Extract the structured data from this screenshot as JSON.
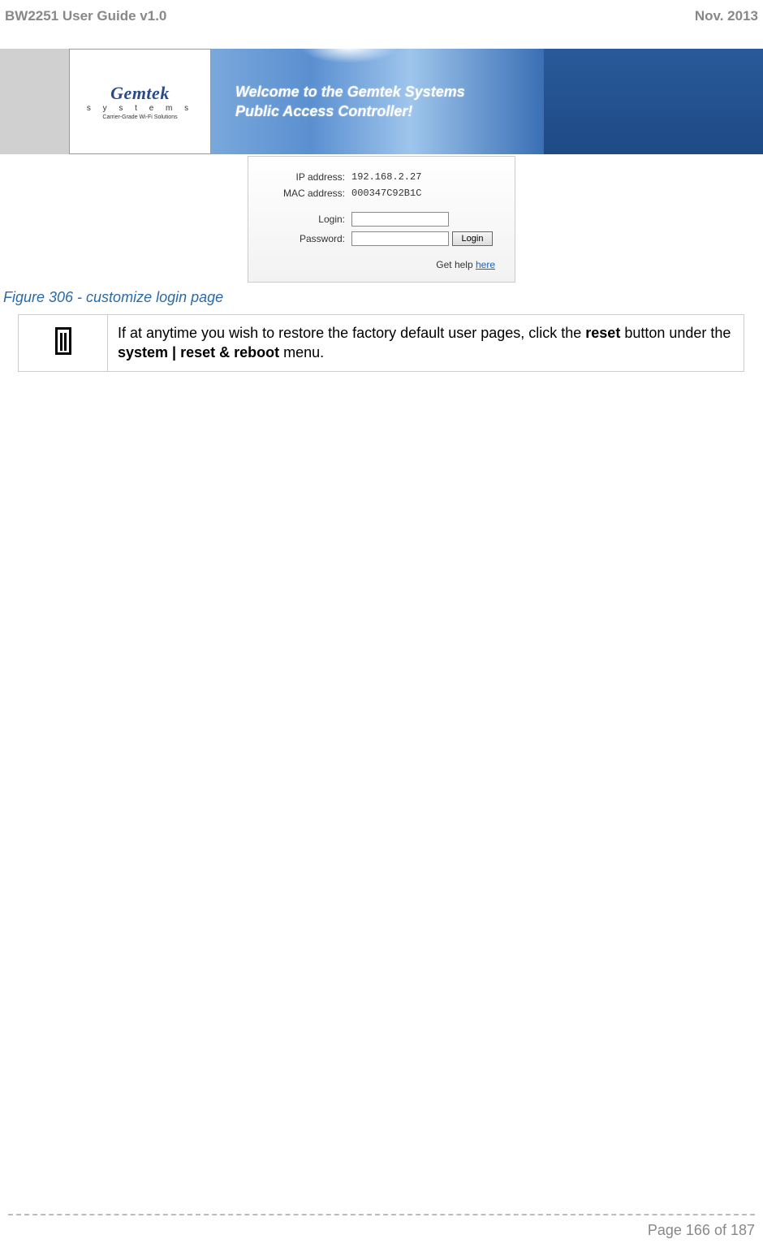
{
  "header": {
    "title": "BW2251 User Guide v1.0",
    "date": "Nov.  2013"
  },
  "logo": {
    "name": "Gemtek",
    "systems": "s y s t e m s",
    "tagline": "Carrier-Grade Wi-Fi Solutions"
  },
  "welcome": {
    "line1": "Welcome to the Gemtek Systems",
    "line2": "Public Access Controller!"
  },
  "login": {
    "ip_label": "IP address:",
    "ip_value": "192.168.2.27",
    "mac_label": "MAC address:",
    "mac_value": "000347C92B1C",
    "login_label": "Login:",
    "login_value": "",
    "password_label": "Password:",
    "password_value": "",
    "button": "Login",
    "help_text": "Get help ",
    "help_link": "here"
  },
  "figure_caption": "Figure 306 - customize login page",
  "info_note": {
    "prefix": "If at anytime you wish to restore the factory default user pages, click the ",
    "reset": "reset",
    "mid": " button under the ",
    "path": "system | reset & reboot",
    "suffix": " menu."
  },
  "footer": {
    "page": "Page 166 of 187"
  }
}
